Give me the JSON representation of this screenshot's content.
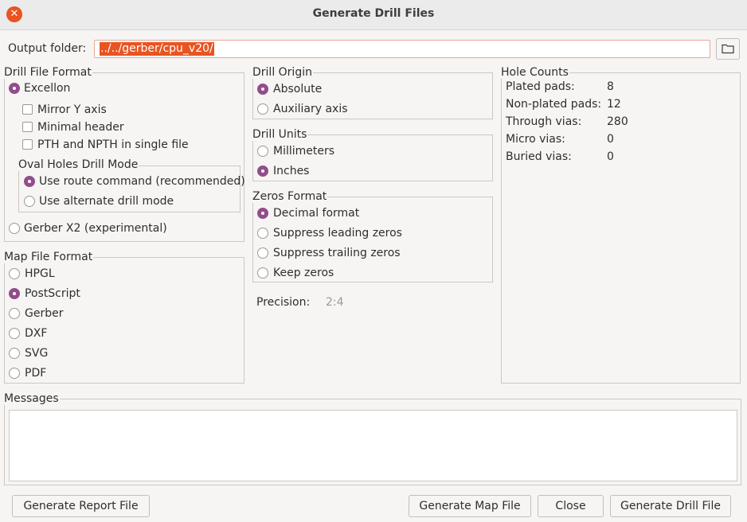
{
  "window": {
    "title": "Generate Drill Files",
    "close_icon": "close-icon"
  },
  "output": {
    "label": "Output folder:",
    "value": "../../gerber/cpu_v20/"
  },
  "drill_file_format": {
    "title": "Drill File Format",
    "excellon_label": "Excellon",
    "mirror_y_label": "Mirror Y axis",
    "minimal_header_label": "Minimal header",
    "pth_npth_label": "PTH and NPTH in single file",
    "oval_holes": {
      "title": "Oval Holes Drill Mode",
      "route_label": "Use route command (recommended)",
      "alternate_label": "Use alternate drill mode"
    },
    "gerber_x2_label": "Gerber X2 (experimental)"
  },
  "map_file_format": {
    "title": "Map File Format",
    "options": [
      "HPGL",
      "PostScript",
      "Gerber",
      "DXF",
      "SVG",
      "PDF"
    ],
    "selected": "PostScript"
  },
  "drill_origin": {
    "title": "Drill Origin",
    "absolute_label": "Absolute",
    "auxiliary_label": "Auxiliary axis"
  },
  "drill_units": {
    "title": "Drill Units",
    "mm_label": "Millimeters",
    "inches_label": "Inches"
  },
  "zeros_format": {
    "title": "Zeros Format",
    "decimal_label": "Decimal format",
    "suppress_leading_label": "Suppress leading zeros",
    "suppress_trailing_label": "Suppress trailing zeros",
    "keep_label": "Keep zeros"
  },
  "precision": {
    "label": "Precision:",
    "value": "2:4"
  },
  "hole_counts": {
    "title": "Hole Counts",
    "rows": [
      {
        "label": "Plated pads:",
        "value": "8"
      },
      {
        "label": "Non-plated pads:",
        "value": "12"
      },
      {
        "label": "Through vias:",
        "value": "280"
      },
      {
        "label": "Micro vias:",
        "value": "0"
      },
      {
        "label": "Buried vias:",
        "value": "0"
      }
    ]
  },
  "messages": {
    "title": "Messages"
  },
  "buttons": {
    "report": "Generate Report File",
    "map": "Generate Map File",
    "close": "Close",
    "drill": "Generate Drill File"
  },
  "colors": {
    "accent": "#e95420",
    "radio_selected": "#924d8b",
    "background": "#f6f5f4"
  }
}
